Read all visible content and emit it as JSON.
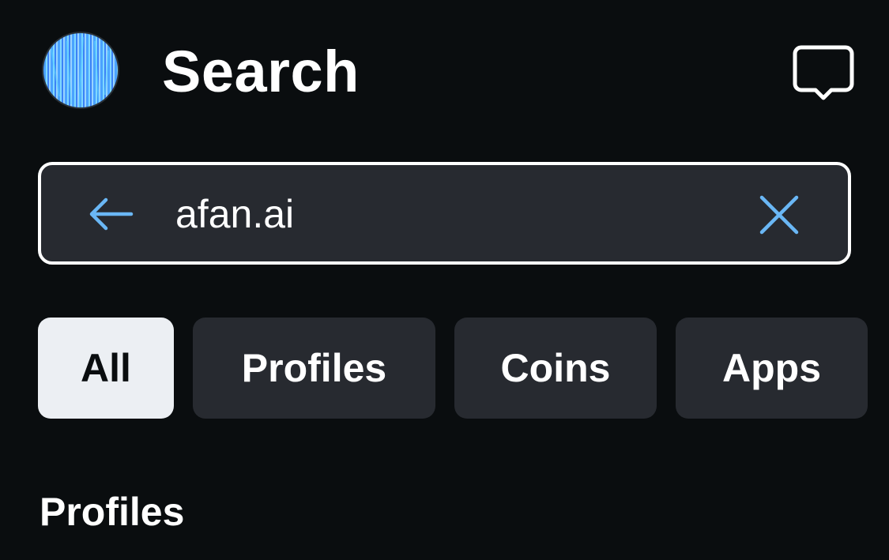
{
  "header": {
    "title": "Search",
    "avatar_icon": "user-avatar",
    "chat_icon": "chat-bubble-icon"
  },
  "search": {
    "value": "afan.ai",
    "back_icon": "arrow-left-icon",
    "clear_icon": "close-icon"
  },
  "tabs": [
    {
      "label": "All",
      "active": true
    },
    {
      "label": "Profiles",
      "active": false
    },
    {
      "label": "Coins",
      "active": false
    },
    {
      "label": "Apps",
      "active": false
    }
  ],
  "sections": {
    "profiles_title": "Profiles"
  },
  "colors": {
    "background": "#0a0d0f",
    "surface": "#272a30",
    "active_tab": "#eceff3",
    "accent": "#6ab7f5"
  }
}
